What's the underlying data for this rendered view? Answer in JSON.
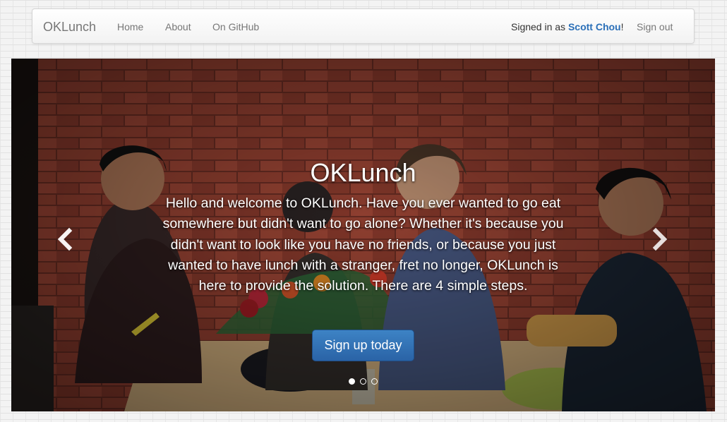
{
  "navbar": {
    "brand": "OKLunch",
    "links": [
      "Home",
      "About",
      "On GitHub"
    ],
    "signed_in_prefix": "Signed in as",
    "user_name": "Scott Chou",
    "signed_in_suffix": "!",
    "sign_out": "Sign out"
  },
  "hero": {
    "title": "OKLunch",
    "body": "Hello and welcome to OKLunch. Have you ever wanted to go eat somewhere but didn't want to go alone? Whether it's because you didn't want to look like you have no friends, or because you just wanted to have lunch with a stranger, fret no longer, OKLunch is here to provide the solution. There are 4 simple steps.",
    "cta_label": "Sign up today",
    "indicators": {
      "count": 3,
      "active": 0
    },
    "prev_icon": "chevron-left-icon",
    "next_icon": "chevron-right-icon"
  },
  "colors": {
    "accent": "#2a6fb8",
    "button": "#3072b8",
    "brick": "#8b3a2b"
  }
}
